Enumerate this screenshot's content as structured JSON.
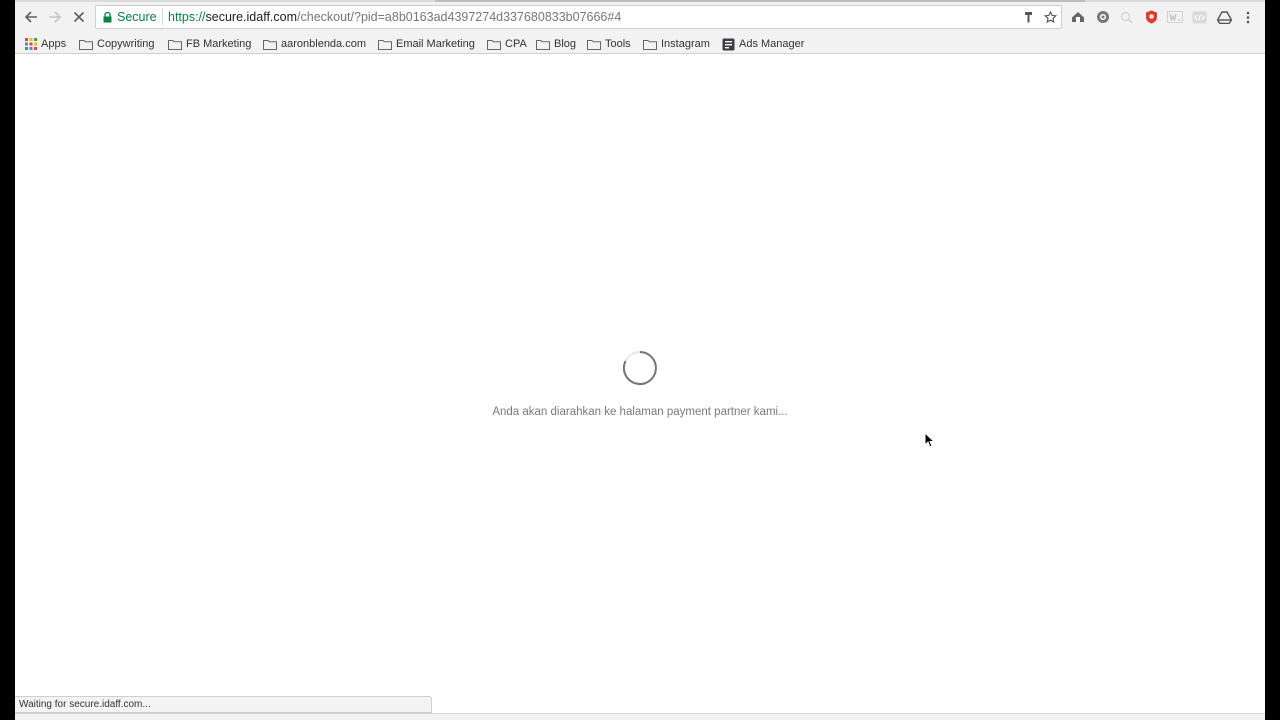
{
  "browser": {
    "omnibox": {
      "security_label": "Secure",
      "url_scheme": "https://",
      "url_host": "secure.idaff.com",
      "url_path": "/checkout/?pid=a8b0163ad4397274d337680833b07666#4"
    },
    "bookmarks": [
      {
        "label": "Apps",
        "icon": "apps-grid-icon"
      },
      {
        "label": "Copywriting",
        "icon": "folder-icon"
      },
      {
        "label": "FB Marketing",
        "icon": "folder-icon"
      },
      {
        "label": "aaronblenda.com",
        "icon": "folder-icon"
      },
      {
        "label": "Email Marketing",
        "icon": "folder-icon"
      },
      {
        "label": "CPA",
        "icon": "folder-icon"
      },
      {
        "label": "Blog",
        "icon": "folder-icon"
      },
      {
        "label": "Tools",
        "icon": "folder-icon"
      },
      {
        "label": "Instagram",
        "icon": "folder-icon"
      },
      {
        "label": "Ads Manager",
        "icon": "ads-manager-icon"
      }
    ],
    "status_text": "Waiting for secure.idaff.com..."
  },
  "page": {
    "loading_message": "Anda akan diarahkan ke halaman payment partner kami..."
  },
  "colors": {
    "secure_green": "#0b8043",
    "toolbar_bg": "#f2f2f2",
    "muted_text": "#7a7a7a"
  }
}
